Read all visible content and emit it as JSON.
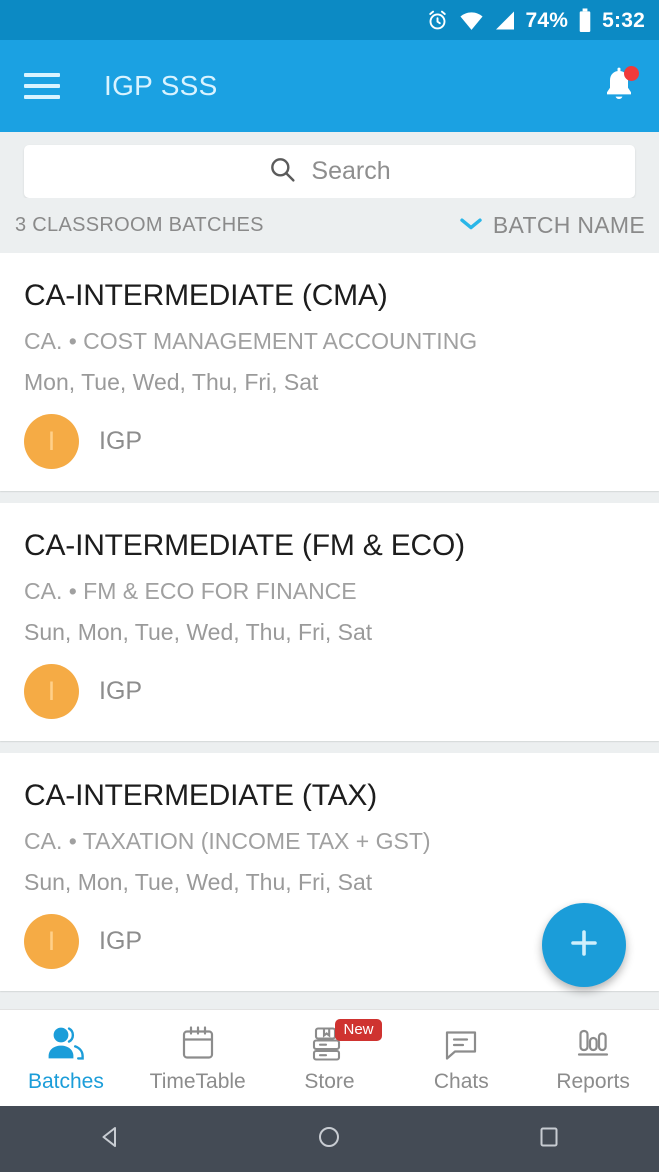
{
  "status_bar": {
    "alarm_icon": "alarm-clock-icon",
    "wifi_icon": "wifi-icon",
    "signal_icon": "cellular-signal-icon",
    "battery_percent": "74%",
    "battery_icon": "battery-icon",
    "time": "5:32"
  },
  "app_bar": {
    "menu_icon": "hamburger-menu-icon",
    "title": "IGP SSS",
    "notification_icon": "bell-icon",
    "has_notification_badge": true,
    "background_color": "#1ba1e2"
  },
  "search": {
    "icon": "search-icon",
    "placeholder": "Search",
    "value": ""
  },
  "list_header": {
    "count_label": "3 CLASSROOM BATCHES",
    "sort_icon": "chevron-down-icon",
    "sort_label": "BATCH NAME",
    "sort_icon_color": "#29b6e8"
  },
  "batches": [
    {
      "title": "CA-INTERMEDIATE (CMA)",
      "subtitle": "CA. • COST MANAGEMENT ACCOUNTING",
      "days": "Mon, Tue, Wed, Thu, Fri, Sat",
      "avatar_initial": "I",
      "owner": "IGP",
      "avatar_color": "#f5ab45"
    },
    {
      "title": "CA-INTERMEDIATE (FM & ECO)",
      "subtitle": "CA. • FM & ECO FOR FINANCE",
      "days": "Sun, Mon, Tue, Wed, Thu, Fri, Sat",
      "avatar_initial": "I",
      "owner": "IGP",
      "avatar_color": "#f5ab45"
    },
    {
      "title": "CA-INTERMEDIATE (TAX)",
      "subtitle": "CA. • TAXATION (INCOME TAX + GST)",
      "days": "Sun, Mon, Tue, Wed, Thu, Fri, Sat",
      "avatar_initial": "I",
      "owner": "IGP",
      "avatar_color": "#f5ab45"
    }
  ],
  "fab": {
    "icon": "plus-icon",
    "color": "#1b9dd9"
  },
  "bottom_nav": {
    "active_color": "#1b9dd9",
    "items": [
      {
        "label": "Batches",
        "icon": "people-icon",
        "active": true,
        "badge": ""
      },
      {
        "label": "TimeTable",
        "icon": "calendar-icon",
        "active": false,
        "badge": ""
      },
      {
        "label": "Store",
        "icon": "books-icon",
        "active": false,
        "badge": "New"
      },
      {
        "label": "Chats",
        "icon": "chat-bubble-icon",
        "active": false,
        "badge": ""
      },
      {
        "label": "Reports",
        "icon": "bar-chart-icon",
        "active": false,
        "badge": ""
      }
    ]
  },
  "android_nav": {
    "back_icon": "back-triangle-icon",
    "home_icon": "home-circle-icon",
    "recents_icon": "recents-square-icon"
  }
}
